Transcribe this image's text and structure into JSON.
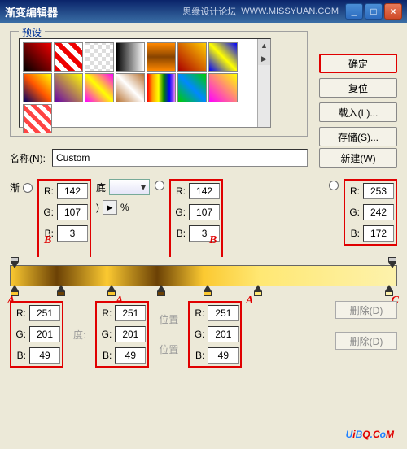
{
  "titlebar": {
    "title": "渐变编辑器",
    "watermark1": "思缘设计论坛",
    "watermark2": "WWW.MISSYUAN.COM"
  },
  "presets": {
    "legend": "预设"
  },
  "buttons": {
    "ok": "确定",
    "reset": "复位",
    "load": "载入(L)...",
    "save": "存储(S)...",
    "new": "新建(W)"
  },
  "name": {
    "label": "名称(N):",
    "value": "Custom"
  },
  "labels": {
    "grad": "渐",
    "R": "R:",
    "G": "G:",
    "B": "B:",
    "pct": "%",
    "pos": "位置",
    "del": "删除(D)",
    "di": "底"
  },
  "upper": {
    "b1": {
      "r": "142",
      "g": "107",
      "b": "3"
    },
    "b2": {
      "r": "142",
      "g": "107",
      "b": "3"
    },
    "c": {
      "r": "253",
      "g": "242",
      "b": "172"
    }
  },
  "lower": {
    "a1": {
      "r": "251",
      "g": "201",
      "b": "49"
    },
    "a2": {
      "r": "251",
      "g": "201",
      "b": "49"
    },
    "a3": {
      "r": "251",
      "g": "201",
      "b": "49"
    }
  },
  "annot": {
    "A": "A",
    "B": "B",
    "C": "C"
  },
  "footer": "UiBQ.CoM"
}
